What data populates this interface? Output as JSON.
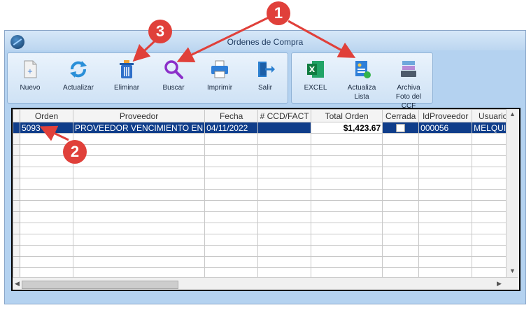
{
  "window": {
    "title": "Ordenes de Compra"
  },
  "toolbar": {
    "nuevo": "Nuevo",
    "actualizar": "Actualizar",
    "eliminar": "Eliminar",
    "buscar": "Buscar",
    "imprimir": "Imprimir",
    "salir": "Salir",
    "excel": "EXCEL",
    "actualiza_lista": "Actualiza Lista",
    "archiva_foto": "Archiva Foto del CCF"
  },
  "grid": {
    "columns": [
      "Orden",
      "Proveedor",
      "Fecha",
      "# CCD/FACT",
      "Total Orden",
      "Cerrada",
      "IdProveedor",
      "Usuario"
    ],
    "rows": [
      {
        "orden": "5093",
        "proveedor": "PROVEEDOR VENCIMIENTO EN",
        "fecha": "04/11/2022",
        "ccd": "",
        "total": "$1,423.67",
        "cerrada": false,
        "idproveedor": "000056",
        "usuario": "MELQUIN"
      }
    ]
  },
  "annotations": {
    "c1": "1",
    "c2": "2",
    "c3": "3"
  },
  "colors": {
    "callout": "#e0403a",
    "selected_row": "#0f3d8a",
    "window_bg": "#b4d2f0"
  }
}
